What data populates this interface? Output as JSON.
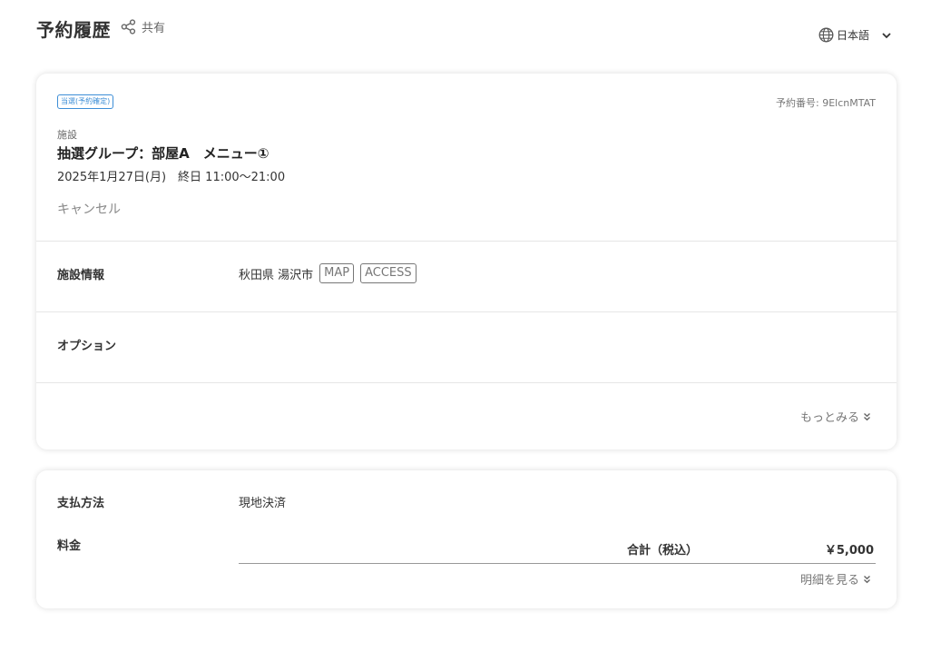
{
  "header": {
    "title": "予約履歴",
    "share_label": "共有",
    "language_label": "日本語"
  },
  "reservation": {
    "status_badge": "当選(予約確定)",
    "reservation_number": "予約番号: 9ElcnMTAT",
    "facility_label": "施設",
    "facility_name": "抽選グループ：部屋A　メニュー①",
    "date_time": "2025年1月27日(月)　終日 11:00〜21:00",
    "cancel_label": "キャンセル"
  },
  "facility_info": {
    "label": "施設情報",
    "address": "秋田県 湯沢市",
    "map_label": "MAP",
    "access_label": "ACCESS"
  },
  "options": {
    "label": "オプション"
  },
  "more_label": "もっとみる",
  "payment": {
    "method_label": "支払方法",
    "method_value": "現地決済",
    "fee_label": "料金",
    "total_label": "合計（税込）",
    "total_value": "￥5,000",
    "detail_label": "明細を見る"
  }
}
